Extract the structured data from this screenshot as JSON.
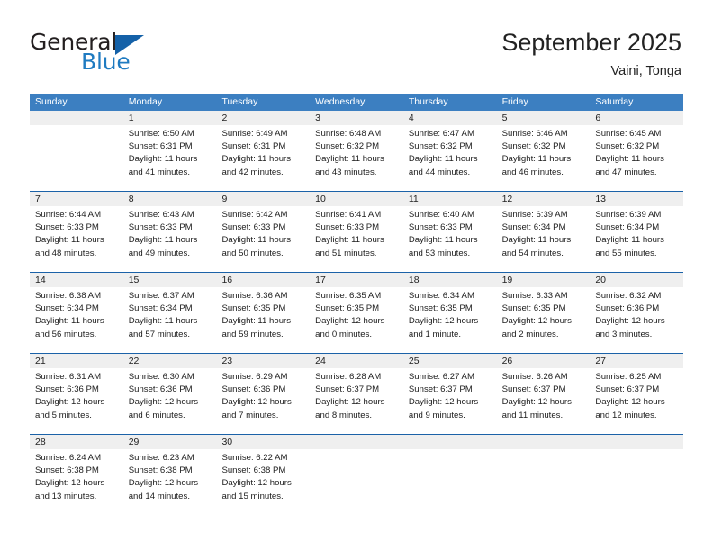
{
  "logo": {
    "word_top": "General",
    "word_bottom": "Blue",
    "triangle_icon": "triangle-icon",
    "colors": {
      "top_text": "#231f20",
      "bottom_text": "#1f7bc1",
      "triangle": "#1461a8"
    }
  },
  "header": {
    "title": "September 2025",
    "location": "Vaini, Tonga"
  },
  "theme": {
    "header_row_background": "#3c7fc1",
    "header_row_text": "#ffffff",
    "row_separator": "#1b62a8",
    "day_number_band": "#efefef",
    "cell_background": "#ffffff"
  },
  "weekdays": [
    "Sunday",
    "Monday",
    "Tuesday",
    "Wednesday",
    "Thursday",
    "Friday",
    "Saturday"
  ],
  "weeks": [
    {
      "days": [
        {
          "date": "",
          "lines": []
        },
        {
          "date": "1",
          "lines": [
            "Sunrise: 6:50 AM",
            "Sunset: 6:31 PM",
            "Daylight: 11 hours",
            "and 41 minutes."
          ]
        },
        {
          "date": "2",
          "lines": [
            "Sunrise: 6:49 AM",
            "Sunset: 6:31 PM",
            "Daylight: 11 hours",
            "and 42 minutes."
          ]
        },
        {
          "date": "3",
          "lines": [
            "Sunrise: 6:48 AM",
            "Sunset: 6:32 PM",
            "Daylight: 11 hours",
            "and 43 minutes."
          ]
        },
        {
          "date": "4",
          "lines": [
            "Sunrise: 6:47 AM",
            "Sunset: 6:32 PM",
            "Daylight: 11 hours",
            "and 44 minutes."
          ]
        },
        {
          "date": "5",
          "lines": [
            "Sunrise: 6:46 AM",
            "Sunset: 6:32 PM",
            "Daylight: 11 hours",
            "and 46 minutes."
          ]
        },
        {
          "date": "6",
          "lines": [
            "Sunrise: 6:45 AM",
            "Sunset: 6:32 PM",
            "Daylight: 11 hours",
            "and 47 minutes."
          ]
        }
      ]
    },
    {
      "days": [
        {
          "date": "7",
          "lines": [
            "Sunrise: 6:44 AM",
            "Sunset: 6:33 PM",
            "Daylight: 11 hours",
            "and 48 minutes."
          ]
        },
        {
          "date": "8",
          "lines": [
            "Sunrise: 6:43 AM",
            "Sunset: 6:33 PM",
            "Daylight: 11 hours",
            "and 49 minutes."
          ]
        },
        {
          "date": "9",
          "lines": [
            "Sunrise: 6:42 AM",
            "Sunset: 6:33 PM",
            "Daylight: 11 hours",
            "and 50 minutes."
          ]
        },
        {
          "date": "10",
          "lines": [
            "Sunrise: 6:41 AM",
            "Sunset: 6:33 PM",
            "Daylight: 11 hours",
            "and 51 minutes."
          ]
        },
        {
          "date": "11",
          "lines": [
            "Sunrise: 6:40 AM",
            "Sunset: 6:33 PM",
            "Daylight: 11 hours",
            "and 53 minutes."
          ]
        },
        {
          "date": "12",
          "lines": [
            "Sunrise: 6:39 AM",
            "Sunset: 6:34 PM",
            "Daylight: 11 hours",
            "and 54 minutes."
          ]
        },
        {
          "date": "13",
          "lines": [
            "Sunrise: 6:39 AM",
            "Sunset: 6:34 PM",
            "Daylight: 11 hours",
            "and 55 minutes."
          ]
        }
      ]
    },
    {
      "days": [
        {
          "date": "14",
          "lines": [
            "Sunrise: 6:38 AM",
            "Sunset: 6:34 PM",
            "Daylight: 11 hours",
            "and 56 minutes."
          ]
        },
        {
          "date": "15",
          "lines": [
            "Sunrise: 6:37 AM",
            "Sunset: 6:34 PM",
            "Daylight: 11 hours",
            "and 57 minutes."
          ]
        },
        {
          "date": "16",
          "lines": [
            "Sunrise: 6:36 AM",
            "Sunset: 6:35 PM",
            "Daylight: 11 hours",
            "and 59 minutes."
          ]
        },
        {
          "date": "17",
          "lines": [
            "Sunrise: 6:35 AM",
            "Sunset: 6:35 PM",
            "Daylight: 12 hours",
            "and 0 minutes."
          ]
        },
        {
          "date": "18",
          "lines": [
            "Sunrise: 6:34 AM",
            "Sunset: 6:35 PM",
            "Daylight: 12 hours",
            "and 1 minute."
          ]
        },
        {
          "date": "19",
          "lines": [
            "Sunrise: 6:33 AM",
            "Sunset: 6:35 PM",
            "Daylight: 12 hours",
            "and 2 minutes."
          ]
        },
        {
          "date": "20",
          "lines": [
            "Sunrise: 6:32 AM",
            "Sunset: 6:36 PM",
            "Daylight: 12 hours",
            "and 3 minutes."
          ]
        }
      ]
    },
    {
      "days": [
        {
          "date": "21",
          "lines": [
            "Sunrise: 6:31 AM",
            "Sunset: 6:36 PM",
            "Daylight: 12 hours",
            "and 5 minutes."
          ]
        },
        {
          "date": "22",
          "lines": [
            "Sunrise: 6:30 AM",
            "Sunset: 6:36 PM",
            "Daylight: 12 hours",
            "and 6 minutes."
          ]
        },
        {
          "date": "23",
          "lines": [
            "Sunrise: 6:29 AM",
            "Sunset: 6:36 PM",
            "Daylight: 12 hours",
            "and 7 minutes."
          ]
        },
        {
          "date": "24",
          "lines": [
            "Sunrise: 6:28 AM",
            "Sunset: 6:37 PM",
            "Daylight: 12 hours",
            "and 8 minutes."
          ]
        },
        {
          "date": "25",
          "lines": [
            "Sunrise: 6:27 AM",
            "Sunset: 6:37 PM",
            "Daylight: 12 hours",
            "and 9 minutes."
          ]
        },
        {
          "date": "26",
          "lines": [
            "Sunrise: 6:26 AM",
            "Sunset: 6:37 PM",
            "Daylight: 12 hours",
            "and 11 minutes."
          ]
        },
        {
          "date": "27",
          "lines": [
            "Sunrise: 6:25 AM",
            "Sunset: 6:37 PM",
            "Daylight: 12 hours",
            "and 12 minutes."
          ]
        }
      ]
    },
    {
      "days": [
        {
          "date": "28",
          "lines": [
            "Sunrise: 6:24 AM",
            "Sunset: 6:38 PM",
            "Daylight: 12 hours",
            "and 13 minutes."
          ]
        },
        {
          "date": "29",
          "lines": [
            "Sunrise: 6:23 AM",
            "Sunset: 6:38 PM",
            "Daylight: 12 hours",
            "and 14 minutes."
          ]
        },
        {
          "date": "30",
          "lines": [
            "Sunrise: 6:22 AM",
            "Sunset: 6:38 PM",
            "Daylight: 12 hours",
            "and 15 minutes."
          ]
        },
        {
          "date": "",
          "lines": []
        },
        {
          "date": "",
          "lines": []
        },
        {
          "date": "",
          "lines": []
        },
        {
          "date": "",
          "lines": []
        }
      ]
    }
  ]
}
